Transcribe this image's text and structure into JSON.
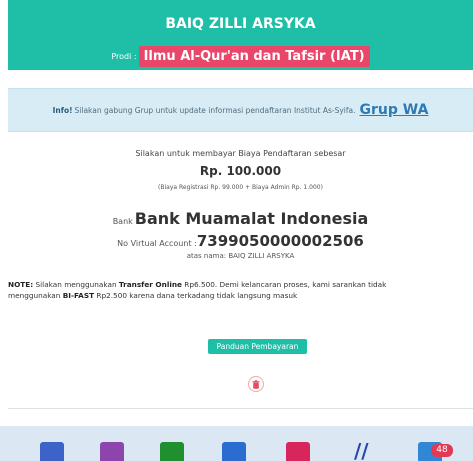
{
  "student": {
    "name": "BAIQ ZILLI ARSYKA",
    "prodi_label": "Prodi :",
    "prodi_value": "Ilmu Al-Qur'an dan Tafsir (IAT)"
  },
  "info": {
    "prefix": "Info!",
    "message": "Silakan gabung Grup untuk update informasi pendaftaran Institut As-Syifa.",
    "link_label": "Grup WA"
  },
  "payment": {
    "instruction": "Silakan untuk membayar Biaya Pendaftaran sebesar",
    "amount": "Rp. 100.000",
    "fee_detail": "(Biaya Registrasi Rp. 99.000 + Biaya Admin Rp. 1.000)",
    "bank_label": "Bank",
    "bank_name": "Bank Muamalat Indonesia",
    "va_label": "No Virtual Account : ",
    "va_number": "7399050000002506",
    "holder": "atas nama: BAIQ ZILLI ARSYKA"
  },
  "note": {
    "label": "NOTE:",
    "part1": " Silakan menggunakan ",
    "transfer_online": "Transfer Online",
    "part2": " Rp6.500. Demi kelancaran proses, kami sarankan tidak",
    "part3": "menggunakan ",
    "bifast": "BI-FAST",
    "part4": " Rp2.500 karena dana terkadang tidak langsung masuk"
  },
  "buttons": {
    "guide": "Panduan Pembayaran"
  },
  "taskbar": {
    "badge": "48",
    "icons": [
      {
        "name": "file-explorer-icon",
        "color": "#3b63c8"
      },
      {
        "name": "app-icon",
        "color": "#8e44ad"
      },
      {
        "name": "xbox-icon",
        "color": "#1f8f2f"
      },
      {
        "name": "store-icon",
        "color": "#2b6cd1"
      },
      {
        "name": "app-red-icon",
        "color": "#d7265b"
      },
      {
        "name": "slash-app-icon",
        "color": "#2a49a5"
      },
      {
        "name": "messaging-icon",
        "color": "#2f87d6"
      }
    ]
  },
  "colors": {
    "header_bg": "#1fbfa7",
    "prodi_bg": "#e8476a",
    "info_bg": "#d8ecf5",
    "button_bg": "#1fbfa7",
    "delete_icon": "#e74c5e"
  }
}
